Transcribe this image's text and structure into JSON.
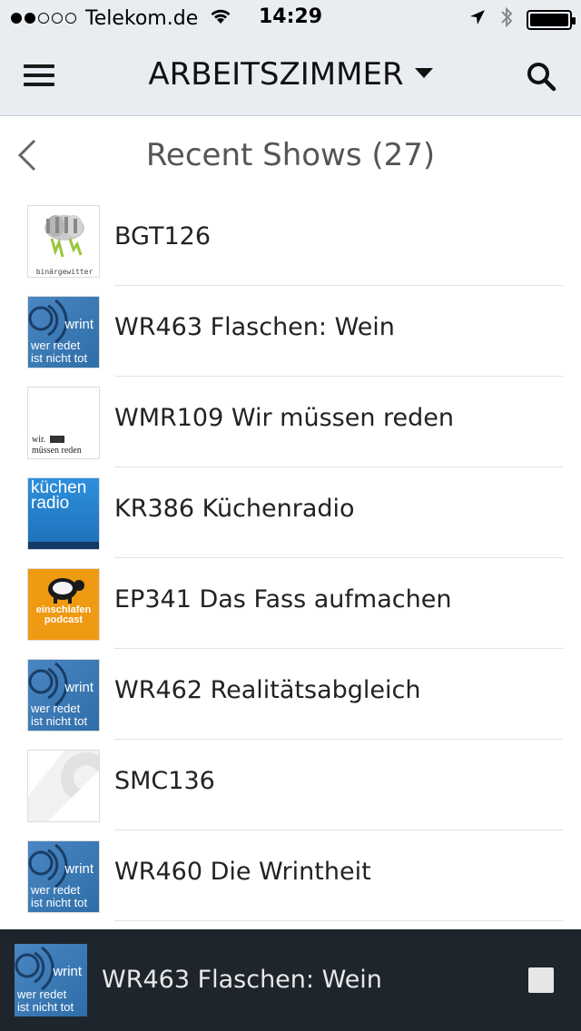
{
  "status_bar": {
    "carrier": "Telekom.de",
    "time": "14:29",
    "signal_bars_filled": 2,
    "signal_bars_total": 5
  },
  "nav": {
    "room_name": "ARBEITSZIMMER",
    "menu_icon": "hamburger-menu-icon",
    "search_icon": "search-icon",
    "dropdown_icon": "caret-down-icon"
  },
  "section": {
    "title": "Recent Shows (27)",
    "back_icon": "chevron-left-icon"
  },
  "shows": [
    {
      "title": "BGT126",
      "thumb": "binaergewitter",
      "thumb_text": "binärgewitter"
    },
    {
      "title": "WR463 Flaschen: Wein",
      "thumb": "wrint",
      "thumb_brand": "wrint",
      "thumb_line1": "wer redet",
      "thumb_line2": "ist nicht tot"
    },
    {
      "title": "WMR109 Wir müssen reden",
      "thumb": "wmr",
      "thumb_line1": "wir.",
      "thumb_line2": "müssen reden"
    },
    {
      "title": "KR386 Küchenradio",
      "thumb": "kuechenradio",
      "thumb_line1": "küchen",
      "thumb_line2": "radio"
    },
    {
      "title": "EP341 Das Fass aufmachen",
      "thumb": "einschlafen",
      "thumb_line1": "einschlafen",
      "thumb_line2": "podcast"
    },
    {
      "title": "WR462 Realitätsabgleich",
      "thumb": "wrint",
      "thumb_brand": "wrint",
      "thumb_line1": "wer redet",
      "thumb_line2": "ist nicht tot"
    },
    {
      "title": "SMC136",
      "thumb": "smc"
    },
    {
      "title": "WR460 Die Wrintheit",
      "thumb": "wrint",
      "thumb_brand": "wrint",
      "thumb_line1": "wer redet",
      "thumb_line2": "ist nicht tot"
    }
  ],
  "now_playing": {
    "title": "WR463 Flaschen: Wein",
    "thumb_brand": "wrint",
    "thumb_line1": "wer redet",
    "thumb_line2": "ist nicht tot",
    "stop_icon": "stop-icon"
  }
}
